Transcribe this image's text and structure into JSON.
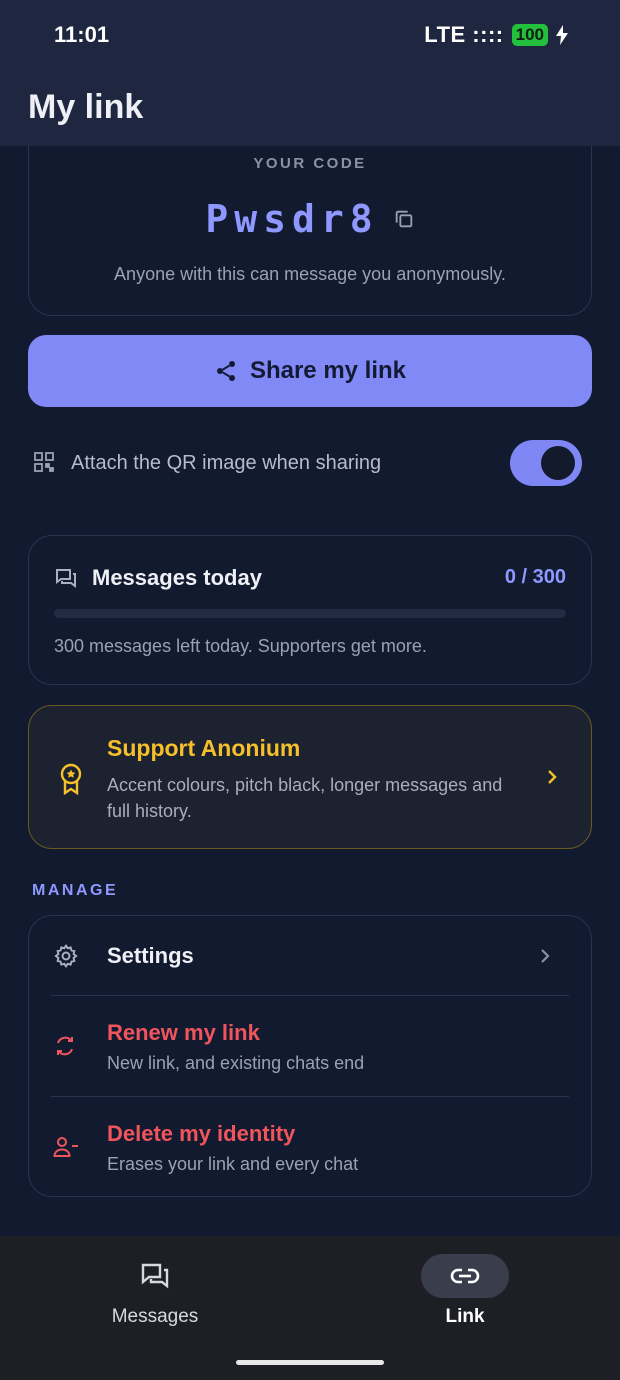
{
  "status_bar": {
    "time": "11:01",
    "network": "LTE ::::",
    "battery": "100"
  },
  "app_bar": {
    "title": "My link"
  },
  "code_card": {
    "label": "YOUR CODE",
    "code": "Pwsdr8",
    "hint": "Anyone with this can message you anonymously.",
    "copy_icon": "copy-icon"
  },
  "share_button": {
    "label": "Share my link",
    "icon": "share-icon"
  },
  "qr_option": {
    "label": "Attach the QR image when sharing",
    "enabled": true,
    "icon": "qr-code-icon"
  },
  "messages_today": {
    "title": "Messages today",
    "count_text": "0 / 300",
    "used": 0,
    "limit": 300,
    "note": "300 messages left today. Supporters get more.",
    "icon": "chat-bubbles-icon"
  },
  "support": {
    "title": "Support Anonium",
    "description": "Accent colours, pitch black, longer messages and full history.",
    "icon": "award-badge-icon"
  },
  "manage": {
    "label": "MANAGE",
    "items": [
      {
        "title": "Settings",
        "subtitle": "",
        "icon": "gear-icon"
      },
      {
        "title": "Renew my link",
        "subtitle": "New link, and existing chats end",
        "icon": "refresh-icon"
      },
      {
        "title": "Delete my identity",
        "subtitle": "Erases your link and every chat",
        "icon": "remove-user-icon"
      }
    ]
  },
  "bottom_nav": {
    "items": [
      {
        "label": "Messages",
        "active": false,
        "icon": "chat-bubbles-icon"
      },
      {
        "label": "Link",
        "active": true,
        "icon": "link-icon"
      }
    ]
  },
  "colors": {
    "accent": "#8189f7",
    "warning": "#f5c02a",
    "danger": "#f0545c",
    "background": "#111a2e"
  }
}
